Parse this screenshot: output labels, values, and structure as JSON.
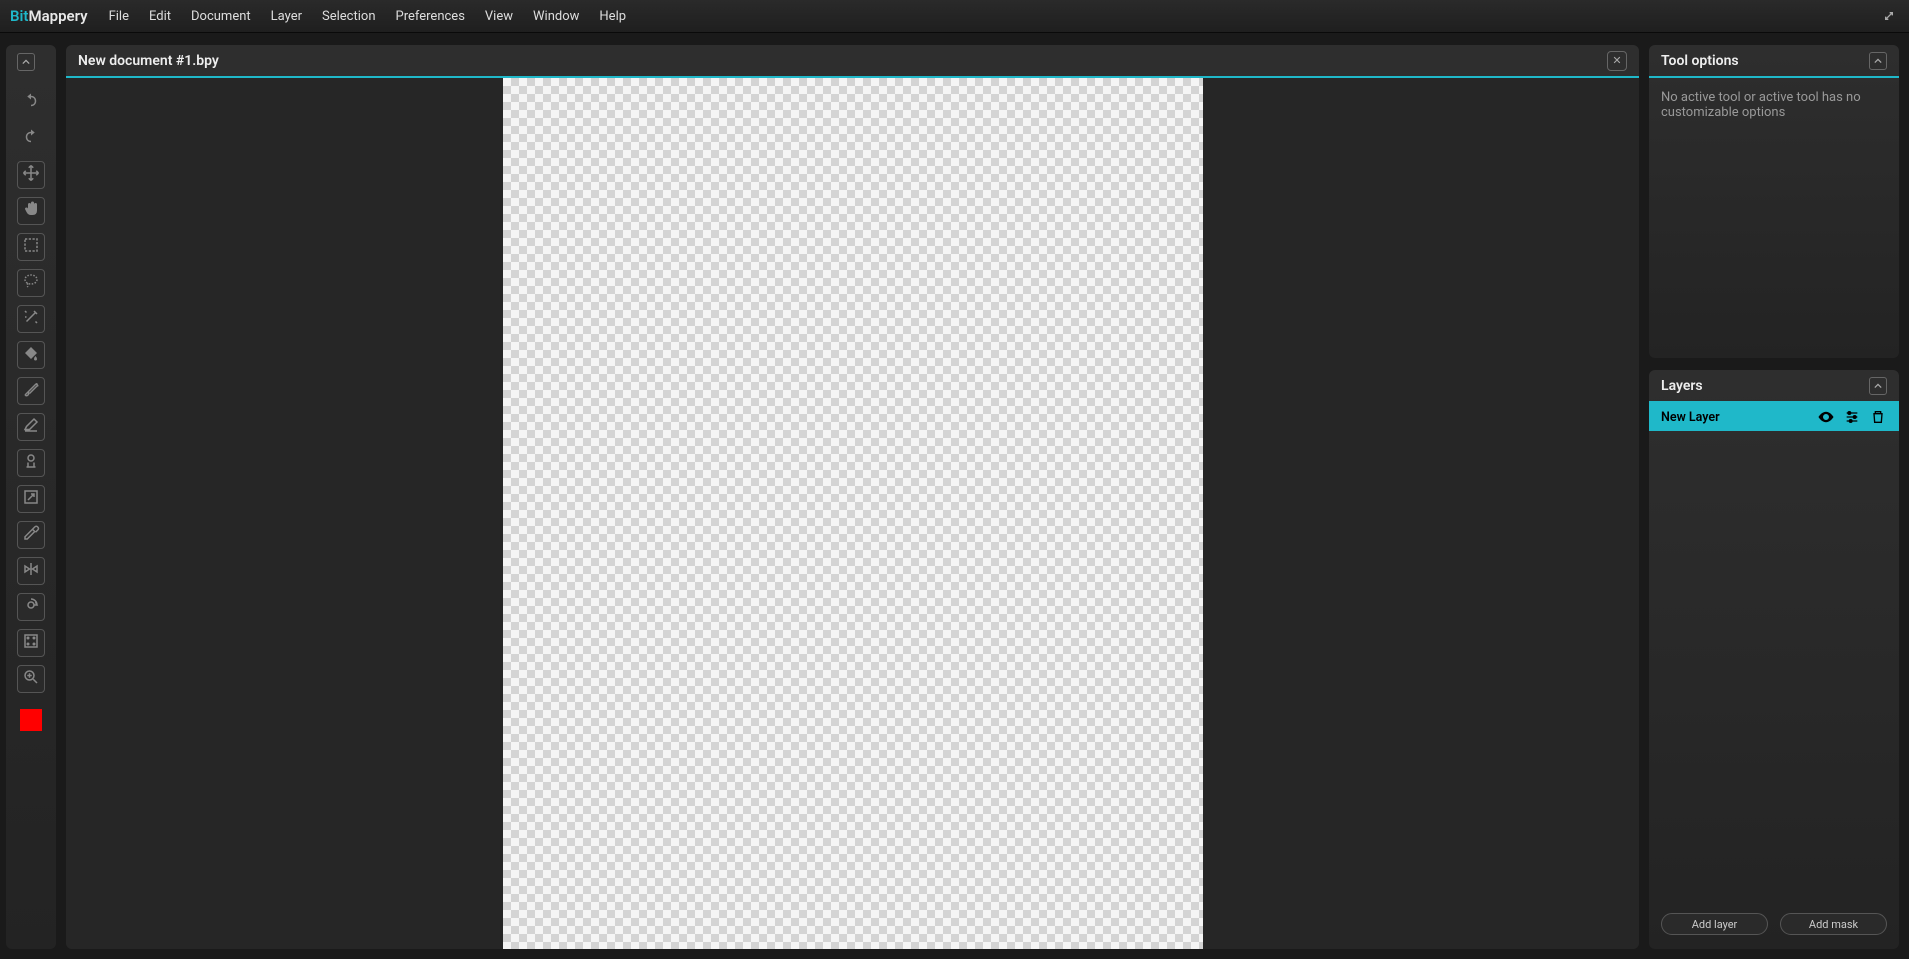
{
  "app": {
    "name_prefix": "Bit",
    "name_suffix": "Mappery"
  },
  "menu": {
    "items": [
      "File",
      "Edit",
      "Document",
      "Layer",
      "Selection",
      "Preferences",
      "View",
      "Window",
      "Help"
    ]
  },
  "toolbar": {
    "tools": [
      {
        "name": "undo-icon"
      },
      {
        "name": "redo-icon"
      },
      {
        "name": "move-icon"
      },
      {
        "name": "hand-icon"
      },
      {
        "name": "rect-select-icon"
      },
      {
        "name": "lasso-icon"
      },
      {
        "name": "wand-icon"
      },
      {
        "name": "fill-icon"
      },
      {
        "name": "brush-icon"
      },
      {
        "name": "eraser-icon"
      },
      {
        "name": "clone-icon"
      },
      {
        "name": "scale-icon"
      },
      {
        "name": "eyedropper-icon"
      },
      {
        "name": "mirror-icon"
      },
      {
        "name": "rotate-icon"
      },
      {
        "name": "text-icon"
      },
      {
        "name": "zoom-icon"
      }
    ],
    "color": "#ff0000"
  },
  "document": {
    "title": "New document #1.bpy"
  },
  "tool_options": {
    "title": "Tool options",
    "empty_text": "No active tool or active tool has no customizable options"
  },
  "layers": {
    "title": "Layers",
    "items": [
      {
        "name": "New Layer"
      }
    ],
    "add_layer_label": "Add layer",
    "add_mask_label": "Add mask"
  }
}
